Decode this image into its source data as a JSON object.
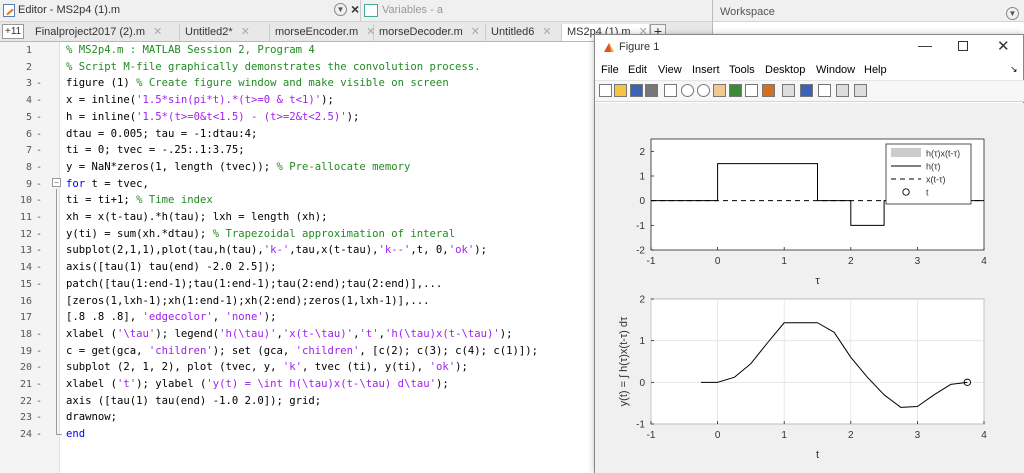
{
  "window": {
    "editor_title": "Editor - MS2p4 (1).m",
    "variables_title": "Variables - a",
    "workspace_title": "Workspace"
  },
  "tabs": {
    "indicator": "+11",
    "items": [
      {
        "label": "Finalproject2017 (2).m"
      },
      {
        "label": "Untitled2*"
      },
      {
        "label": "morseEncoder.m"
      },
      {
        "label": "morseDecoder.m"
      },
      {
        "label": "Untitled6"
      },
      {
        "label": "MS2p4 (1).m"
      }
    ],
    "add_label": "+"
  },
  "code": {
    "lines": [
      {
        "n": "1",
        "d": "",
        "segs": [
          [
            "cmt",
            "% MS2p4.m : MATLAB Session 2, Program 4"
          ]
        ]
      },
      {
        "n": "2",
        "d": "",
        "segs": [
          [
            "cmt",
            "% Script M-file graphically demonstrates the convolution process."
          ]
        ]
      },
      {
        "n": "3",
        "d": "-",
        "segs": [
          [
            "",
            "figure (1) "
          ],
          [
            "cmt",
            "% Create figure window and make visible on screen"
          ]
        ]
      },
      {
        "n": "4",
        "d": "-",
        "segs": [
          [
            "",
            "x = inline("
          ],
          [
            "str",
            "'1.5*sin(pi*t).*(t>=0 & t<1)'"
          ],
          [
            "",
            ");"
          ]
        ]
      },
      {
        "n": "5",
        "d": "-",
        "segs": [
          [
            "",
            "h = inline("
          ],
          [
            "str",
            "'1.5*(t>=0&t<1.5) - (t>=2&t<2.5)'"
          ],
          [
            "",
            ");"
          ]
        ]
      },
      {
        "n": "6",
        "d": "-",
        "segs": [
          [
            "",
            "dtau = 0.005; tau = -1:dtau:4;"
          ]
        ]
      },
      {
        "n": "7",
        "d": "-",
        "segs": [
          [
            "",
            "ti = 0; tvec = -.25:.1:3.75;"
          ]
        ]
      },
      {
        "n": "8",
        "d": "-",
        "segs": [
          [
            "",
            "y = NaN*zeros(1, length (tvec)); "
          ],
          [
            "cmt",
            "% Pre-allocate memory"
          ]
        ]
      },
      {
        "n": "9",
        "d": "-",
        "segs": [
          [
            "kw",
            "for"
          ],
          [
            "",
            " t = tvec,"
          ]
        ]
      },
      {
        "n": "10",
        "d": "-",
        "segs": [
          [
            "",
            "ti = ti+1; "
          ],
          [
            "cmt",
            "% Time index"
          ]
        ]
      },
      {
        "n": "11",
        "d": "-",
        "segs": [
          [
            "",
            "xh = x(t-tau).*h(tau); lxh = length (xh);"
          ]
        ]
      },
      {
        "n": "12",
        "d": "-",
        "segs": [
          [
            "",
            "y(ti) = sum(xh.*dtau); "
          ],
          [
            "cmt",
            "% Trapezoidal approximation of interal"
          ]
        ]
      },
      {
        "n": "13",
        "d": "-",
        "segs": [
          [
            "",
            "subplot(2,1,1),plot(tau,h(tau),"
          ],
          [
            "str",
            "'k-'"
          ],
          [
            "",
            ",tau,x(t-tau),"
          ],
          [
            "str",
            "'k--'"
          ],
          [
            "",
            ",t, 0,"
          ],
          [
            "str",
            "'ok'"
          ],
          [
            "",
            ");"
          ]
        ]
      },
      {
        "n": "14",
        "d": "-",
        "segs": [
          [
            "",
            "axis([tau(1) tau(end) -2.0 2.5]);"
          ]
        ]
      },
      {
        "n": "15",
        "d": "-",
        "segs": [
          [
            "",
            "patch([tau(1:end-1);tau(1:end-1);tau(2:end);tau(2:end)],..."
          ]
        ]
      },
      {
        "n": "16",
        "d": "",
        "segs": [
          [
            "",
            "[zeros(1,lxh-1);xh(1:end-1);xh(2:end);zeros(1,lxh-1)],..."
          ]
        ]
      },
      {
        "n": "17",
        "d": "",
        "segs": [
          [
            "",
            "[.8 .8 .8], "
          ],
          [
            "str",
            "'edgecolor'"
          ],
          [
            "",
            ", "
          ],
          [
            "str",
            "'none'"
          ],
          [
            "",
            ");"
          ]
        ]
      },
      {
        "n": "18",
        "d": "-",
        "segs": [
          [
            "",
            "xlabel ("
          ],
          [
            "str",
            "'\\tau'"
          ],
          [
            "",
            "); legend("
          ],
          [
            "str",
            "'h(\\tau)'"
          ],
          [
            "",
            ","
          ],
          [
            "str",
            "'x(t-\\tau)'"
          ],
          [
            "",
            ","
          ],
          [
            "str",
            "'t'"
          ],
          [
            "",
            ","
          ],
          [
            "str",
            "'h(\\tau)x(t-\\tau)'"
          ],
          [
            "",
            ");"
          ]
        ]
      },
      {
        "n": "19",
        "d": "-",
        "segs": [
          [
            "",
            "c = get(gca, "
          ],
          [
            "str",
            "'children'"
          ],
          [
            "",
            "); set (gca, "
          ],
          [
            "str",
            "'children'"
          ],
          [
            "",
            ", [c(2); c(3); c(4); c(1)]);"
          ]
        ]
      },
      {
        "n": "20",
        "d": "-",
        "segs": [
          [
            "",
            "subplot (2, 1, 2), plot (tvec, y, "
          ],
          [
            "str",
            "'k'"
          ],
          [
            "",
            ", tvec (ti), y(ti), "
          ],
          [
            "str",
            "'ok'"
          ],
          [
            "",
            ");"
          ]
        ]
      },
      {
        "n": "21",
        "d": "-",
        "segs": [
          [
            "",
            "xlabel ("
          ],
          [
            "str",
            "'t'"
          ],
          [
            "",
            "); ylabel ("
          ],
          [
            "str",
            "'y(t) = \\int h(\\tau)x(t-\\tau) d\\tau'"
          ],
          [
            "",
            ");"
          ]
        ]
      },
      {
        "n": "22",
        "d": "-",
        "segs": [
          [
            "",
            "axis ([tau(1) tau(end) -1.0 2.0]); grid;"
          ]
        ]
      },
      {
        "n": "23",
        "d": "-",
        "segs": [
          [
            "",
            "drawnow;"
          ]
        ]
      },
      {
        "n": "24",
        "d": "-",
        "segs": [
          [
            "kw",
            "end"
          ]
        ]
      }
    ]
  },
  "figure": {
    "title": "Figure 1",
    "min_label": "—",
    "close_label": "✕",
    "menu": [
      "File",
      "Edit",
      "View",
      "Insert",
      "Tools",
      "Desktop",
      "Window",
      "Help"
    ],
    "menu_arrow": "↘",
    "toolbar_icons": [
      "new-file-icon",
      "open-folder-icon",
      "save-icon",
      "print-icon",
      "pointer-icon",
      "zoom-in-icon",
      "zoom-out-icon",
      "pan-icon",
      "rotate-icon",
      "data-cursor-icon",
      "brush-icon",
      "link-icon",
      "colorbar-icon",
      "legend-icon",
      "hide-plot-tools-icon",
      "show-plot-tools-icon"
    ]
  },
  "chart_data": [
    {
      "type": "line",
      "xlim": [
        -1,
        4
      ],
      "ylim": [
        -2,
        2.5
      ],
      "xticks": [
        -1,
        0,
        1,
        2,
        3,
        4
      ],
      "yticks": [
        -2,
        -1,
        0,
        1,
        2
      ],
      "xlabel": "τ",
      "ylabel": "",
      "grid": false,
      "legend_position": "top-right",
      "series": [
        {
          "name": "h(τ)x(t-τ)",
          "style": "patch",
          "color": "#cccccc",
          "x": [],
          "y": []
        },
        {
          "name": "h(τ)",
          "style": "solid",
          "color": "#000000",
          "x": [
            -1,
            0,
            0,
            1.5,
            1.5,
            2,
            2,
            2.5,
            2.5,
            4
          ],
          "y": [
            0,
            0,
            1.5,
            1.5,
            0,
            0,
            -1,
            -1,
            0,
            0
          ]
        },
        {
          "name": "x(t-τ)",
          "style": "dashed",
          "color": "#000000",
          "x": [
            -1,
            4
          ],
          "y": [
            0,
            0
          ]
        },
        {
          "name": "t",
          "style": "marker",
          "color": "#000000",
          "x": [],
          "y": []
        }
      ]
    },
    {
      "type": "line",
      "xlim": [
        -1,
        4
      ],
      "ylim": [
        -1,
        2
      ],
      "xticks": [
        -1,
        0,
        1,
        2,
        3,
        4
      ],
      "yticks": [
        -1,
        0,
        1,
        2
      ],
      "xlabel": "t",
      "ylabel": "y(t) = ∫ h(τ)x(t-τ) dτ",
      "grid": true,
      "series": [
        {
          "name": "",
          "style": "solid",
          "color": "#000000",
          "x": [
            -0.25,
            0,
            0.25,
            0.5,
            0.75,
            1.0,
            1.5,
            1.75,
            2.0,
            2.25,
            2.5,
            2.75,
            3.0,
            3.25,
            3.5,
            3.75
          ],
          "y": [
            0,
            0,
            0.12,
            0.45,
            0.95,
            1.43,
            1.43,
            1.2,
            0.6,
            0.12,
            -0.3,
            -0.6,
            -0.58,
            -0.3,
            -0.05,
            0
          ]
        },
        {
          "name": "",
          "style": "marker",
          "color": "#000000",
          "x": [
            3.75
          ],
          "y": [
            0
          ]
        }
      ]
    }
  ]
}
